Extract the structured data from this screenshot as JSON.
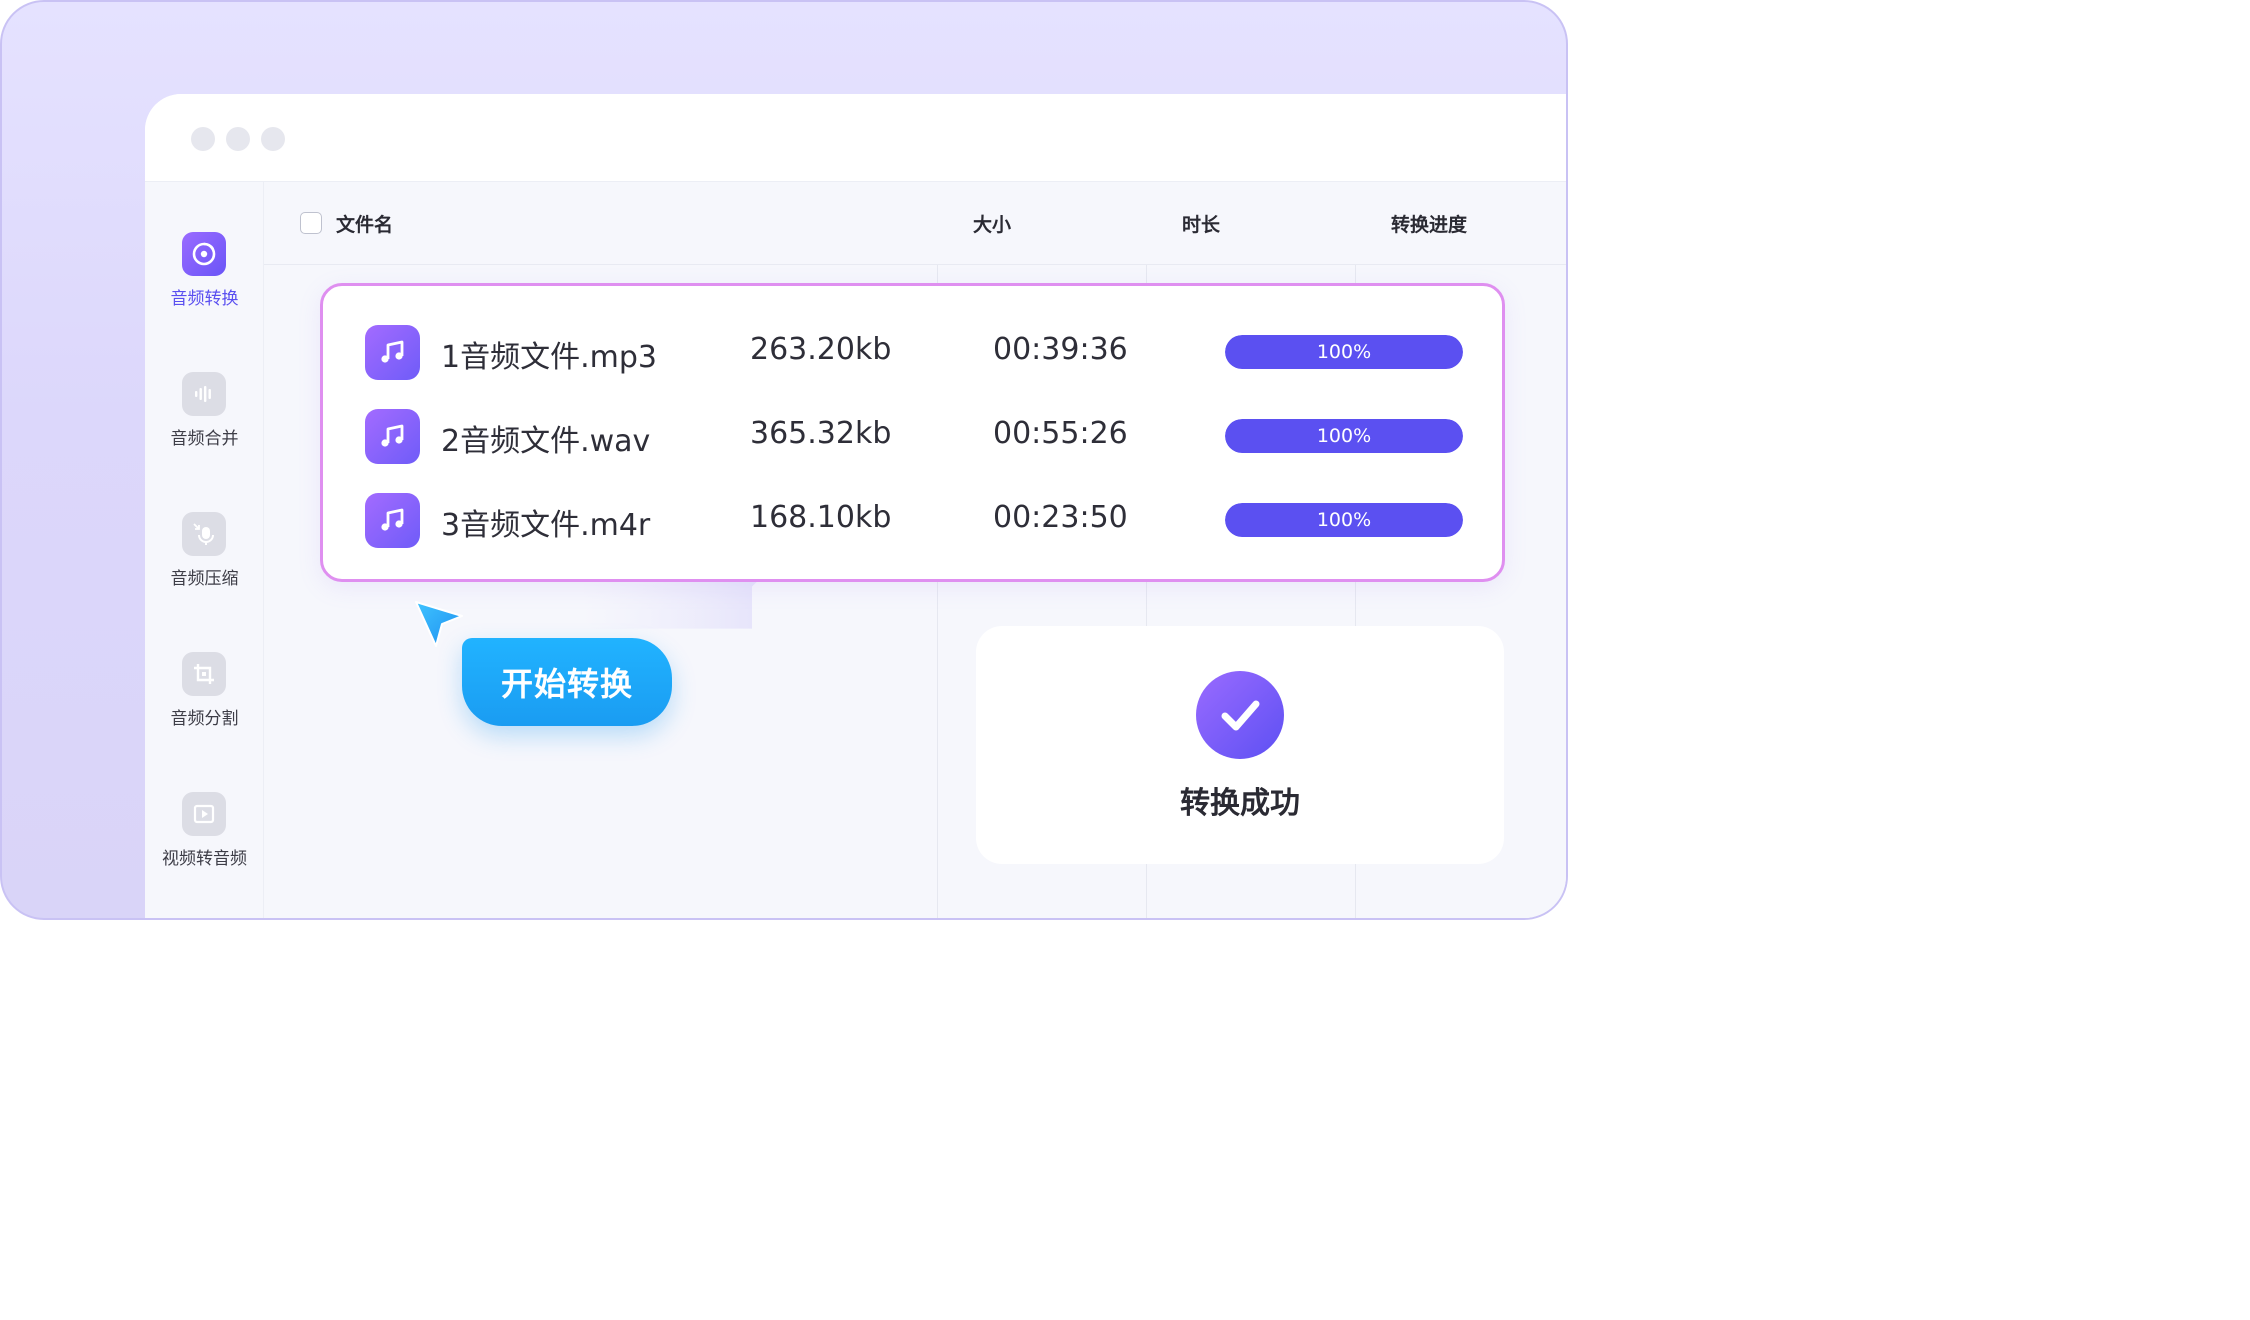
{
  "window": {
    "controls": [
      "window-dot",
      "window-dot",
      "window-dot"
    ]
  },
  "sidebar": {
    "items": [
      {
        "label": "音频转换",
        "icon": "disc-icon",
        "active": true
      },
      {
        "label": "音频合并",
        "icon": "waveform-icon",
        "active": false
      },
      {
        "label": "音频压缩",
        "icon": "microphone-compress-icon",
        "active": false
      },
      {
        "label": "音频分割",
        "icon": "crop-icon",
        "active": false
      },
      {
        "label": "视频转音频",
        "icon": "video-play-icon",
        "active": false
      }
    ]
  },
  "table": {
    "headers": {
      "name": "文件名",
      "size": "大小",
      "duration": "时长",
      "progress": "转换进度"
    },
    "rows": [
      {
        "name": "1音频文件.mp3",
        "size": "263.20kb",
        "duration": "00:39:36",
        "progress_label": "100%",
        "progress": 1.0
      },
      {
        "name": "2音频文件.wav",
        "size": "365.32kb",
        "duration": "00:55:26",
        "progress_label": "100%",
        "progress": 1.0
      },
      {
        "name": "3音频文件.m4r",
        "size": "168.10kb",
        "duration": "00:23:50",
        "progress_label": "100%",
        "progress": 1.0
      }
    ]
  },
  "actions": {
    "start_label": "开始转换"
  },
  "result": {
    "label": "转换成功",
    "icon": "check-circle-icon"
  },
  "colors": {
    "accent": "#5b50f1",
    "button": "#1a9cf2",
    "panel_border": "#df8ff0"
  }
}
